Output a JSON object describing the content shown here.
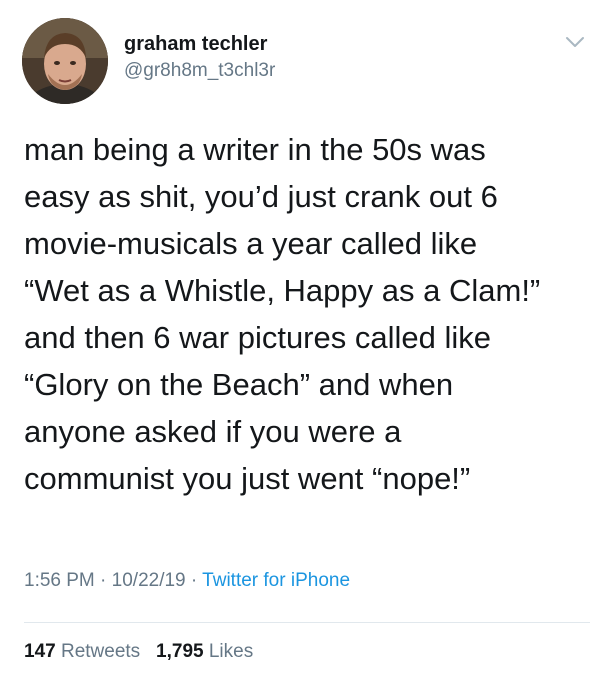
{
  "author": {
    "display_name": "graham techler",
    "handle": "@gr8h8m_t3chl3r",
    "avatar_icon": "user-avatar-photo"
  },
  "tweet": {
    "lines": [
      "man being a writer in the 50s was",
      "easy as shit, you’d just crank out 6",
      "movie-musicals a year called like",
      "“Wet as a Whistle, Happy as a Clam!”",
      "and then 6 war pictures called like",
      "“Glory on the Beach” and when",
      "anyone asked if you were a",
      "communist you just went “nope!”"
    ]
  },
  "meta": {
    "time": "1:56 PM",
    "separator": "·",
    "date": "10/22/19",
    "source": "Twitter for iPhone"
  },
  "stats": {
    "retweets_count": "147",
    "retweets_label": "Retweets",
    "likes_count": "1,795",
    "likes_label": "Likes"
  },
  "colors": {
    "text": "#14171a",
    "secondary": "#657786",
    "link": "#1b95e0",
    "divider": "#e1e8ed"
  },
  "icons": {
    "menu": "chevron-down-icon"
  }
}
